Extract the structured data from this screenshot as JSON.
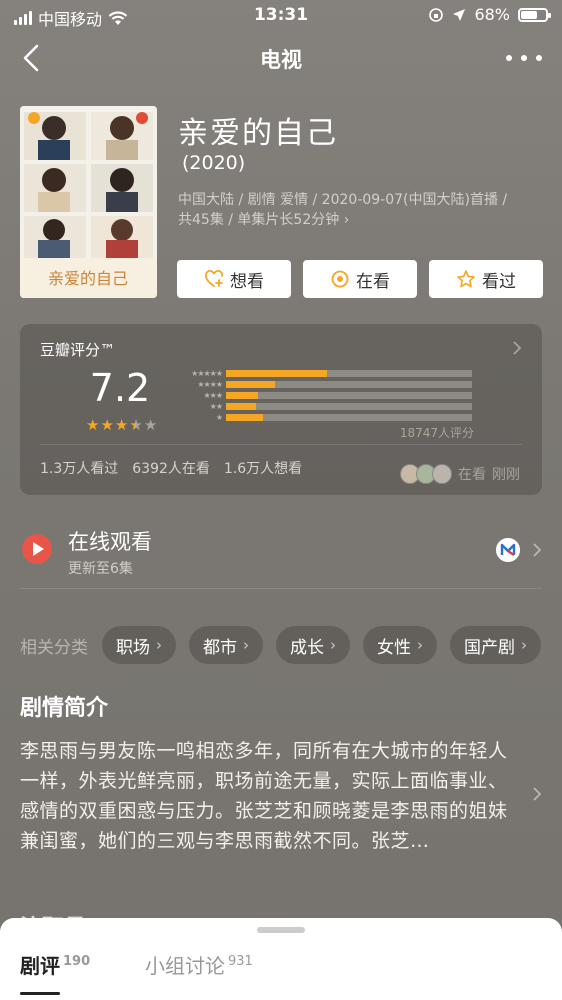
{
  "status_bar": {
    "carrier": "中国移动",
    "time": "13:31",
    "battery": "68%",
    "battery_level": 0.68
  },
  "nav": {
    "title": "电视"
  },
  "show": {
    "title": "亲爱的自己",
    "year": "(2020)",
    "meta_line1": "中国大陆 / 剧情 爱情 / 2020-09-07(中国大陆)首播 /",
    "meta_line2": "共45集 / 单集片长52分钟 ›",
    "poster_text": "亲爱的自己"
  },
  "actions": {
    "want": "想看",
    "watching": "在看",
    "watched": "看过"
  },
  "rating": {
    "label": "豆瓣评分™",
    "score": "7.2",
    "stars": 3.5,
    "count": "18747人评分",
    "distribution": [
      0.41,
      0.2,
      0.13,
      0.12,
      0.15
    ],
    "seen": "1.3万人看过",
    "watching": "6392人在看",
    "want": "1.6万人想看",
    "watchers_status": "在看",
    "watchers_time": "刚刚"
  },
  "online": {
    "title": "在线观看",
    "subtitle": "更新至6集"
  },
  "tags": {
    "label": "相关分类",
    "items": [
      "职场",
      "都市",
      "成长",
      "女性",
      "国产剧"
    ]
  },
  "synopsis": {
    "title": "剧情简介",
    "text": "李思雨与男友陈一鸣相恋多年，同所有在大城市的年轻人一样，外表光鲜亮丽，职场前途无量，实际上面临事业、感情的双重困惑与压力。张芝芝和顾晓菱是李思雨的姐妹兼闺蜜，她们的三观与李思雨截然不同。张芝…"
  },
  "next_section": "演职员",
  "sheet": {
    "tab_reviews": "剧评",
    "tab_reviews_count": "190",
    "tab_groups": "小组讨论",
    "tab_groups_count": "931"
  },
  "colors": {
    "accent_star": "#f5a623",
    "play_red": "#e8564a"
  }
}
